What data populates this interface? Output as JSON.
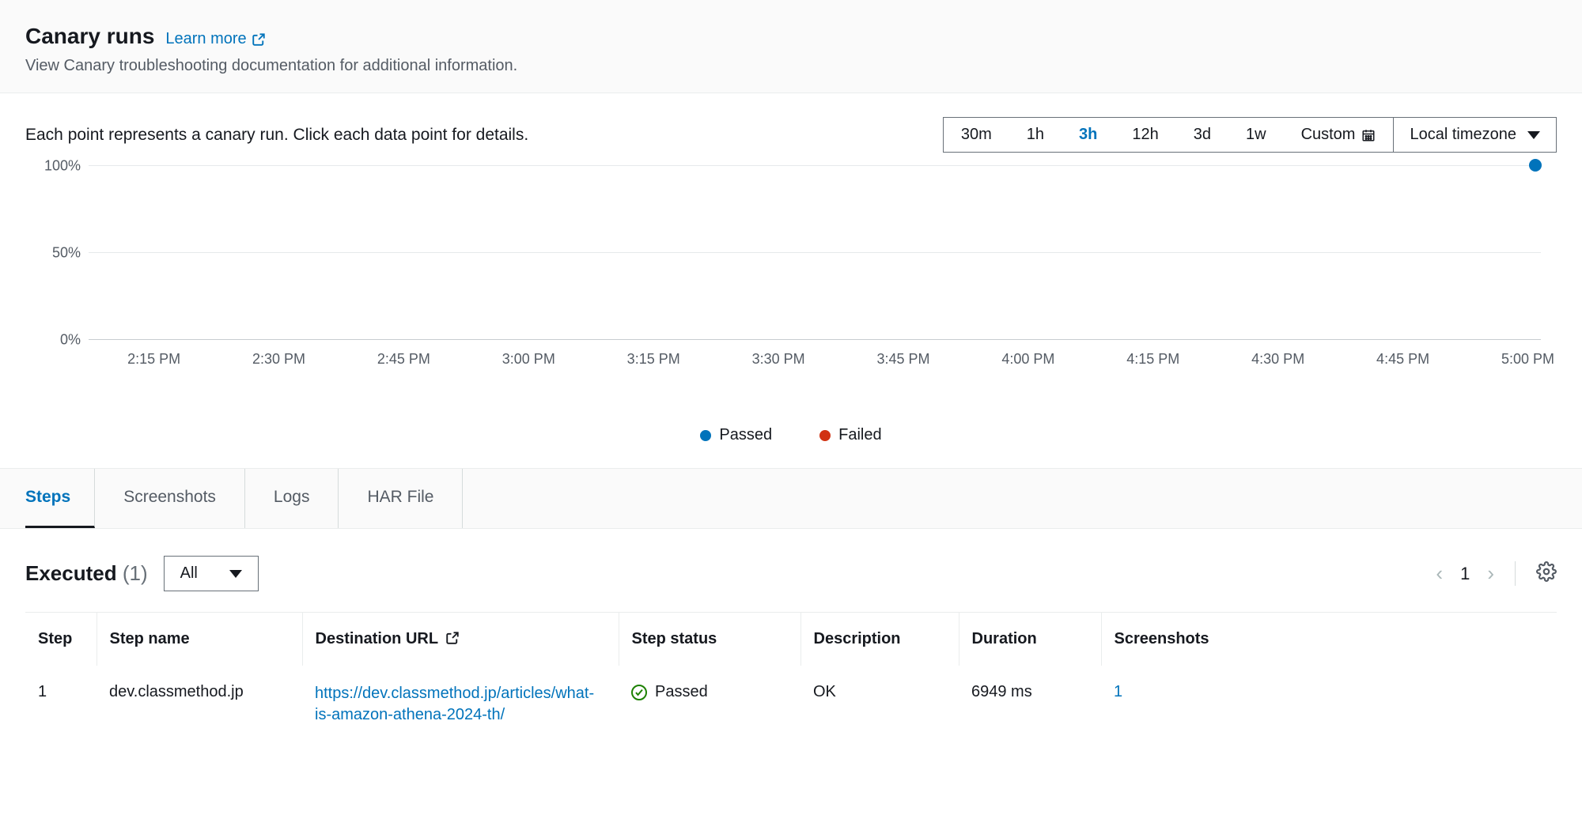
{
  "header": {
    "title": "Canary runs",
    "learn_more": "Learn more",
    "subtitle": "View Canary troubleshooting documentation for additional information."
  },
  "chart": {
    "description": "Each point represents a canary run. Click each data point for details.",
    "range_options": [
      "30m",
      "1h",
      "3h",
      "12h",
      "3d",
      "1w"
    ],
    "range_active": "3h",
    "custom_label": "Custom",
    "timezone_label": "Local timezone",
    "legend": {
      "passed": "Passed",
      "failed": "Failed"
    },
    "colors": {
      "passed": "#0073bb",
      "failed": "#d13212"
    }
  },
  "chart_data": {
    "type": "scatter",
    "title": "",
    "xlabel": "",
    "ylabel": "",
    "ylim": [
      0,
      100
    ],
    "y_ticks": [
      "100%",
      "50%",
      "0%"
    ],
    "categories": [
      "2:15 PM",
      "2:30 PM",
      "2:45 PM",
      "3:00 PM",
      "3:15 PM",
      "3:30 PM",
      "3:45 PM",
      "4:00 PM",
      "4:15 PM",
      "4:30 PM",
      "4:45 PM",
      "5:00 PM"
    ],
    "series": [
      {
        "name": "Passed",
        "color": "#0073bb",
        "points": [
          {
            "x": "5:03 PM",
            "y": 100
          }
        ]
      },
      {
        "name": "Failed",
        "color": "#d13212",
        "points": []
      }
    ]
  },
  "tabs": {
    "items": [
      "Steps",
      "Screenshots",
      "Logs",
      "HAR File"
    ],
    "active": "Steps"
  },
  "executed": {
    "label": "Executed",
    "count": "(1)",
    "filter_value": "All",
    "page_current": "1"
  },
  "table": {
    "headers": {
      "step": "Step",
      "name": "Step name",
      "url": "Destination URL",
      "status": "Step status",
      "desc": "Description",
      "duration": "Duration",
      "screenshots": "Screenshots"
    },
    "rows": [
      {
        "step": "1",
        "name": "dev.classmethod.jp",
        "url": "https://dev.classmethod.jp/articles/what-is-amazon-athena-2024-th/",
        "status_label": "Passed",
        "desc": "OK",
        "duration": "6949 ms",
        "screenshots": "1"
      }
    ]
  }
}
